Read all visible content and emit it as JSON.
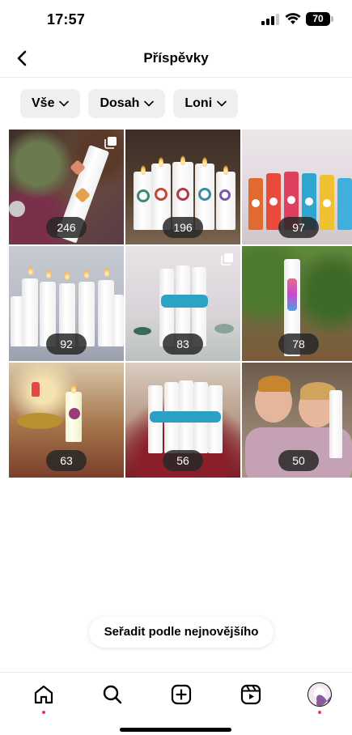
{
  "status_bar": {
    "time": "17:57",
    "battery": "70"
  },
  "header": {
    "title": "Příspěvky"
  },
  "filters": [
    {
      "label": "Vše"
    },
    {
      "label": "Dosah"
    },
    {
      "label": "Loni"
    }
  ],
  "posts": [
    {
      "views": "246",
      "multiple": true
    },
    {
      "views": "196",
      "multiple": false
    },
    {
      "views": "97",
      "multiple": false
    },
    {
      "views": "92",
      "multiple": false
    },
    {
      "views": "83",
      "multiple": true
    },
    {
      "views": "78",
      "multiple": false
    },
    {
      "views": "63",
      "multiple": false
    },
    {
      "views": "56",
      "multiple": false
    },
    {
      "views": "50",
      "multiple": false
    }
  ],
  "sort_button": {
    "label": "Seřadit podle nejnovějšího"
  },
  "tabbar": {
    "items": [
      {
        "icon": "home-icon",
        "active_dot": true
      },
      {
        "icon": "search-icon",
        "active_dot": false
      },
      {
        "icon": "create-post-icon",
        "active_dot": false
      },
      {
        "icon": "reels-icon",
        "active_dot": false
      },
      {
        "icon": "profile-avatar",
        "active_dot": true
      }
    ],
    "dot_color": "#ff2d55"
  }
}
